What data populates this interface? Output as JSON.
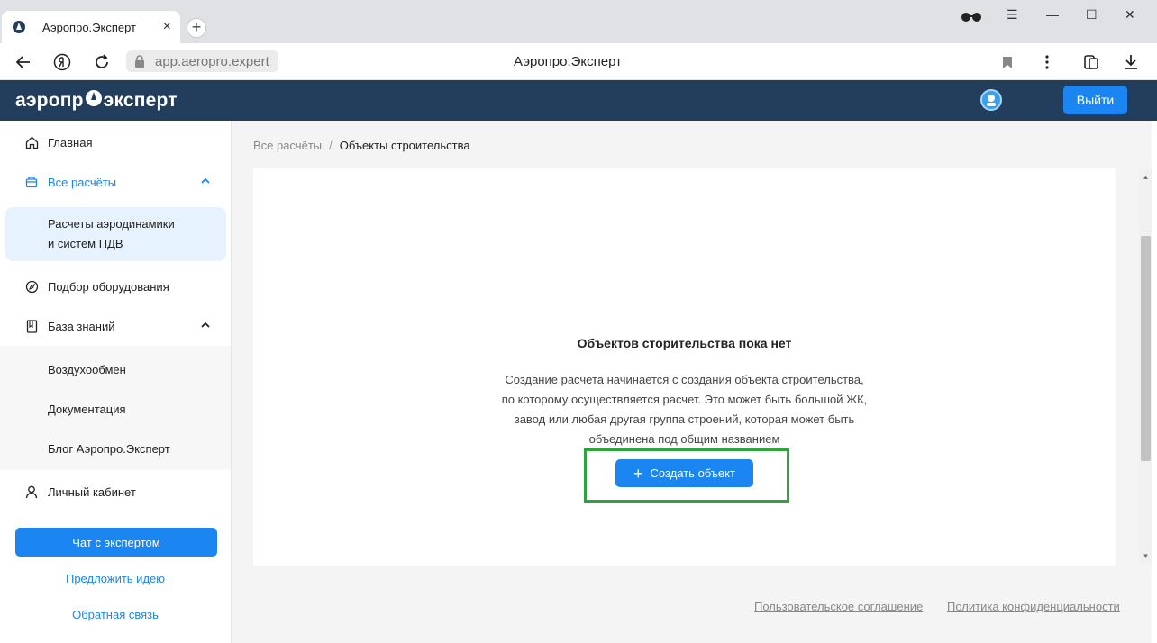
{
  "browser": {
    "tab_title": "Аэропро.Эксперт",
    "tab_close": "×",
    "new_tab": "+",
    "url": "app.aeropro.expert",
    "page_title": "Аэропро.Эксперт",
    "window_controls": {
      "menu": "☰",
      "minimize": "—",
      "maximize": "☐",
      "close": "✕"
    }
  },
  "header": {
    "logo_left": "аэропр",
    "logo_right": "эксперт",
    "logout_label": "Выйти"
  },
  "sidebar": {
    "home": "Главная",
    "all_calcs": "Все расчёты",
    "aero_calc_line1": "Расчеты аэродинамики",
    "aero_calc_line2": "и систем ПДВ",
    "equipment": "Подбор оборудования",
    "knowledge": "База знаний",
    "air_exchange": "Воздухообмен",
    "docs": "Документация",
    "blog": "Блог Аэропро.Эксперт",
    "account": "Личный кабинет",
    "chat_button": "Чат с экспертом",
    "suggest_idea": "Предложить идею",
    "feedback": "Обратная связь"
  },
  "main": {
    "breadcrumb_parent": "Все расчёты",
    "breadcrumb_sep": "/",
    "breadcrumb_current": "Объекты строительства",
    "empty_title": "Объектов сторительства пока нет",
    "empty_desc_1": "Создание расчета начинается с создания объекта строительства,",
    "empty_desc_2": "по которому осуществляется расчет. Это может быть большой ЖК,",
    "empty_desc_3": "завод или любая другая группа строений, которая может быть",
    "empty_desc_4": "объединена под общим названием",
    "create_plus": "+",
    "create_label": "Создать объект",
    "footer_terms": "Пользовательское соглашение",
    "footer_privacy": "Политика конфиденциальности"
  },
  "colors": {
    "header_bg": "#233d5c",
    "accent": "#1b86f2",
    "highlight": "#2ba43b"
  }
}
